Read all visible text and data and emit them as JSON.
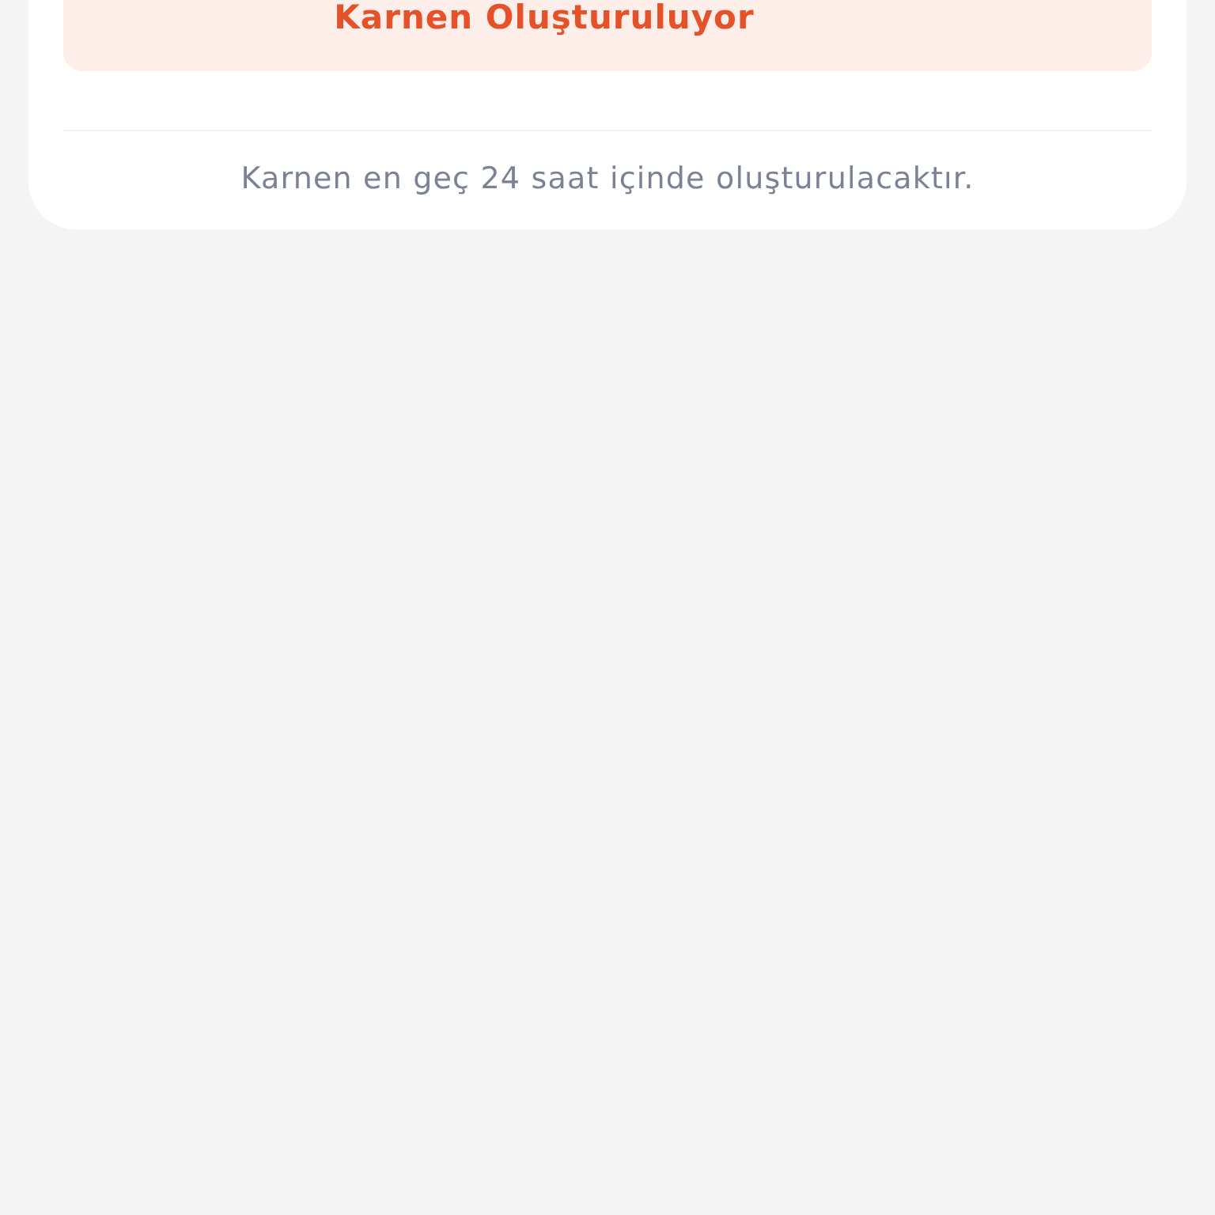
{
  "status_banner": {
    "text": "Karnen Oluşturuluyor"
  },
  "note": "Karnen en geç 24 saat içinde oluşturulacaktır."
}
